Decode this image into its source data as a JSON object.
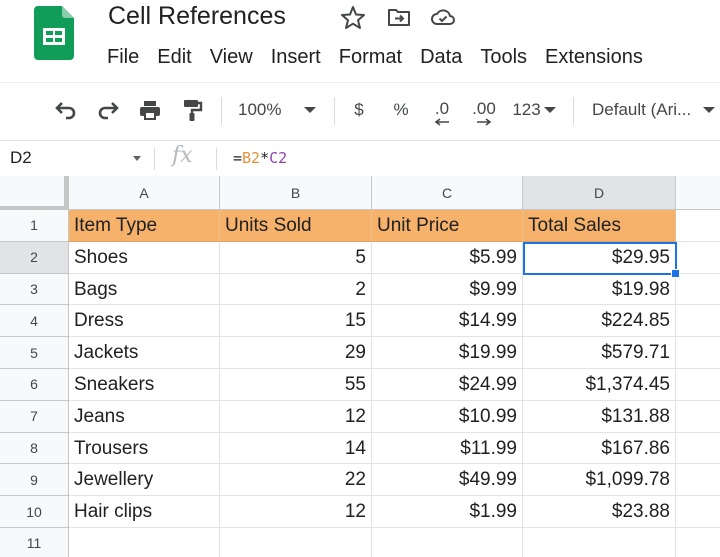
{
  "header": {
    "title": "Cell References",
    "icons": [
      "star-icon",
      "move-to-folder-icon",
      "cloud-status-icon"
    ]
  },
  "menu": {
    "items": [
      "File",
      "Edit",
      "View",
      "Insert",
      "Format",
      "Data",
      "Tools",
      "Extensions"
    ]
  },
  "toolbar": {
    "zoom": "100%",
    "currency": "$",
    "percent": "%",
    "decrease_decimal": ".0",
    "increase_decimal": ".00",
    "more_formats": "123",
    "font": "Default (Ari..."
  },
  "formula_bar": {
    "name_box": "D2",
    "fx": "fx",
    "formula_eq": "=",
    "formula_ref1": "B2",
    "formula_op": "*",
    "formula_ref2": "C2"
  },
  "sheet": {
    "columns": [
      "A",
      "B",
      "C",
      "D"
    ],
    "rows": [
      "1",
      "2",
      "3",
      "4",
      "5",
      "6",
      "7",
      "8",
      "9",
      "10",
      "11"
    ],
    "selected_cell": "D2",
    "header_fill_color": "#f6b26b",
    "selection_color": "#1a73e8",
    "headers": [
      "Item Type",
      "Units Sold",
      "Unit Price",
      "Total Sales"
    ],
    "data": [
      [
        "Shoes",
        "5",
        "$5.99",
        "$29.95"
      ],
      [
        "Bags",
        "2",
        "$9.99",
        "$19.98"
      ],
      [
        "Dress",
        "15",
        "$14.99",
        "$224.85"
      ],
      [
        "Jackets",
        "29",
        "$19.99",
        "$579.71"
      ],
      [
        "Sneakers",
        "55",
        "$24.99",
        "$1,374.45"
      ],
      [
        "Jeans",
        "12",
        "$10.99",
        "$131.88"
      ],
      [
        "Trousers",
        "14",
        "$11.99",
        "$167.86"
      ],
      [
        "Jewellery",
        "22",
        "$49.99",
        "$1,099.78"
      ],
      [
        "Hair clips",
        "12",
        "$1.99",
        "$23.88"
      ]
    ]
  }
}
